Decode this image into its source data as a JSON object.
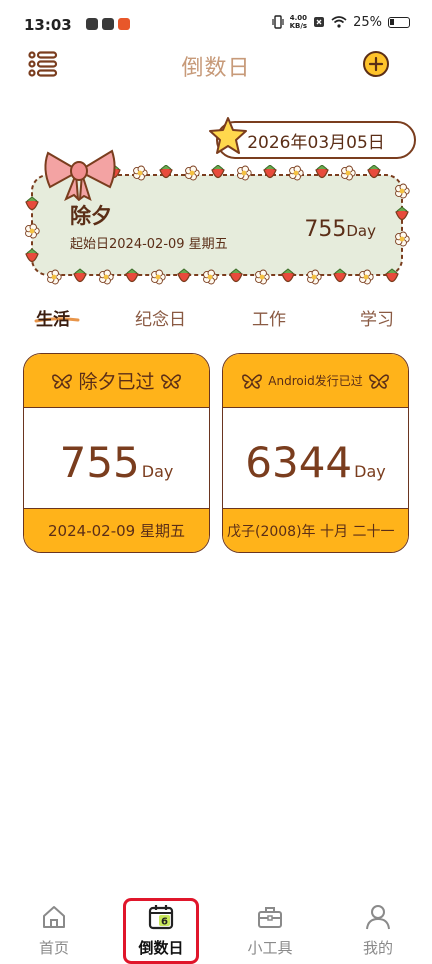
{
  "status_bar": {
    "time": "13:03",
    "net_speed_value": "4.00",
    "net_speed_unit": "KB/s",
    "battery": "25%"
  },
  "header": {
    "title": "倒数日",
    "menu_icon": "list-menu-icon",
    "add_icon": "plus-circle-icon"
  },
  "hero": {
    "date": "2026年03月05日",
    "name": "除夕",
    "start": "起始日2024-02-09 星期五",
    "days": "755",
    "unit": "Day"
  },
  "tabs": [
    {
      "label": "生活",
      "active": true
    },
    {
      "label": "纪念日",
      "active": false
    },
    {
      "label": "工作",
      "active": false
    },
    {
      "label": "学习",
      "active": false
    }
  ],
  "cards": [
    {
      "title": "除夕已过",
      "days": "755",
      "unit": "Day",
      "date": "2024-02-09 星期五"
    },
    {
      "title": "Android发行已过",
      "days": "6344",
      "unit": "Day",
      "date": "戊子(2008)年 十月 二十一"
    }
  ],
  "bottom_nav": [
    {
      "label": "首页",
      "icon": "home-icon",
      "active": false
    },
    {
      "label": "倒数日",
      "icon": "calendar-icon",
      "active": true,
      "badge": "6"
    },
    {
      "label": "小工具",
      "icon": "toolbox-icon",
      "active": false
    },
    {
      "label": "我的",
      "icon": "profile-icon",
      "active": false
    }
  ],
  "colors": {
    "accent": "#ffb31a",
    "brown": "#5b2e17",
    "title": "#c79a79",
    "highlight": "#e0162b"
  }
}
